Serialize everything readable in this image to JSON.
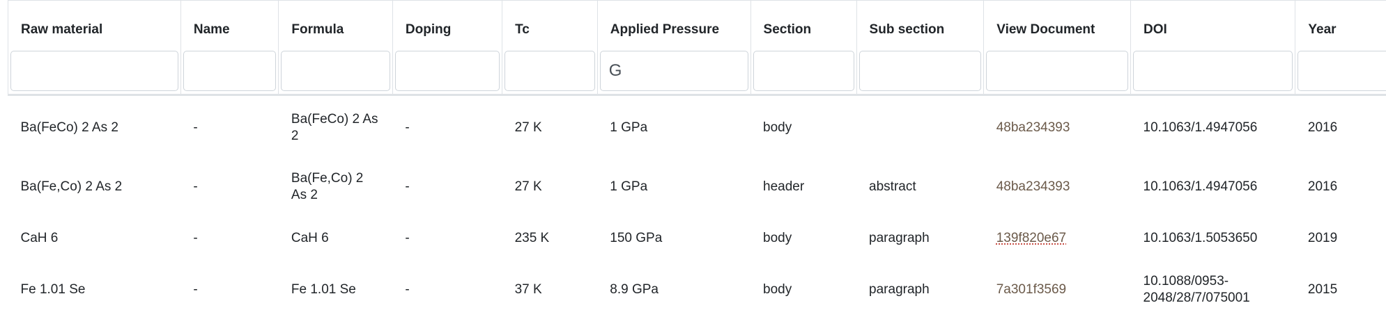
{
  "columns": [
    {
      "key": "raw_material",
      "label": "Raw material",
      "filter": ""
    },
    {
      "key": "name",
      "label": "Name",
      "filter": ""
    },
    {
      "key": "formula",
      "label": "Formula",
      "filter": ""
    },
    {
      "key": "doping",
      "label": "Doping",
      "filter": ""
    },
    {
      "key": "tc",
      "label": "Tc",
      "filter": ""
    },
    {
      "key": "applied_pressure",
      "label": "Applied Pressure",
      "filter": "G"
    },
    {
      "key": "section",
      "label": "Section",
      "filter": ""
    },
    {
      "key": "sub_section",
      "label": "Sub section",
      "filter": ""
    },
    {
      "key": "view_document",
      "label": "View Document",
      "filter": ""
    },
    {
      "key": "doi",
      "label": "DOI",
      "filter": ""
    },
    {
      "key": "year",
      "label": "Year",
      "filter": ""
    }
  ],
  "rows": [
    {
      "raw_material": "Ba(FeCo) 2 As 2",
      "name": "-",
      "formula": "Ba(FeCo) 2 As 2",
      "doping": "-",
      "tc": "27 K",
      "applied_pressure": "1 GPa",
      "section": "body",
      "sub_section": "",
      "view_document": "48ba234393",
      "doi": "10.1063/1.4947056",
      "year": "2016"
    },
    {
      "raw_material": "Ba(Fe,Co) 2 As 2",
      "name": "-",
      "formula": "Ba(Fe,Co) 2 As 2",
      "doping": "-",
      "tc": "27 K",
      "applied_pressure": "1 GPa",
      "section": "header",
      "sub_section": "abstract",
      "view_document": "48ba234393",
      "doi": "10.1063/1.4947056",
      "year": "2016"
    },
    {
      "raw_material": "CaH 6",
      "name": "-",
      "formula": "CaH 6",
      "doping": "-",
      "tc": "235 K",
      "applied_pressure": "150 GPa",
      "section": "body",
      "sub_section": "paragraph",
      "view_document": "139f820e67",
      "doi": "10.1063/1.5053650",
      "year": "2019"
    },
    {
      "raw_material": "Fe 1.01 Se",
      "name": "-",
      "formula": "Fe 1.01 Se",
      "doping": "-",
      "tc": "37 K",
      "applied_pressure": "8.9 GPa",
      "section": "body",
      "sub_section": "paragraph",
      "view_document": "7a301f3569",
      "doi": "10.1088/0953-2048/28/7/075001",
      "year": "2015"
    }
  ],
  "colors": {
    "link": "#6b5a4a",
    "border": "#dee2e6",
    "text": "#212529"
  }
}
